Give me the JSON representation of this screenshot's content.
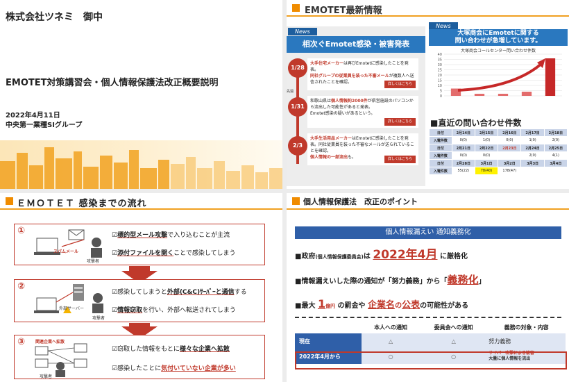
{
  "slide1": {
    "company": "株式会社ツネミ　御中",
    "title": "EMOTET対策講習会・個人情報保護法改正概要説明",
    "date": "2022年4月11日",
    "org": "中央第一業種SIグループ"
  },
  "slide2": {
    "header": "EMOTET最新情報",
    "news_tag": "News",
    "news_headline": "相次ぐEmotet感染・被害発表",
    "side_label": "先週",
    "items": [
      {
        "date": "1/28",
        "red": "大手住宅メーカー",
        "text1": "は再びEmotetに感染したことを発表。",
        "red2": "同社グループの従業員を装った不審メール",
        "text2": "が複数人へ送信されたことを確認。",
        "btn": "詳しくはこちら"
      },
      {
        "date": "1/31",
        "text0": "和歌山県は",
        "red": "個人情報約2000件",
        "text1": "が県営施設のパソコンから流出した可能性があると発表。",
        "text2": "Emotet感染の疑いがあるという。",
        "btn": "詳しくはこちら"
      },
      {
        "date": "2/3",
        "red": "大手生活用品メーカー",
        "text1": "はEmotetに感染したことを発表。同社従業員を装った不審なメールが送られていることを確認。",
        "red2": "個人情報の一部流出",
        "text2": "も。",
        "btn": "詳しくはこちら"
      }
    ],
    "news2_tag": "News",
    "news2_headline_1": "大塚商会にEmotetに関する",
    "news2_headline_2": "問い合わせが急増しています。",
    "chart_title": "大塚商会コールセンター問い合わせ件数",
    "table_title": "■直近の問い合わせ件数",
    "table": {
      "row_labels": [
        "日付",
        "入電件数"
      ],
      "weeks": [
        {
          "dates": [
            "2月14日",
            "2月15日",
            "2月16日",
            "2月17日",
            "2月18日"
          ],
          "counts": [
            "0(0)",
            "1(0)",
            "0(0)",
            "1(0)",
            "2(0)"
          ]
        },
        {
          "dates": [
            "2月21日",
            "2月22日",
            "2月23日",
            "2月24日",
            "2月25日"
          ],
          "counts": [
            "0(0)",
            "0(0)",
            "",
            "2(0)",
            "4(1)"
          ]
        },
        {
          "dates": [
            "2月28日",
            "3月1日",
            "3月2日",
            "3月3日",
            "3月4日"
          ],
          "counts": [
            "55(22)",
            "78(40)",
            "178(47)",
            "",
            ""
          ]
        }
      ]
    }
  },
  "chart_data": {
    "type": "bar",
    "title": "大塚商会コールセンター問い合わせ件数",
    "categories": [
      "",
      "",
      "",
      "",
      ""
    ],
    "values": [
      7,
      2,
      2,
      4,
      36
    ],
    "ylim": [
      0,
      40
    ],
    "yticks": [
      0,
      5,
      10,
      15,
      20,
      25,
      30,
      35,
      40
    ],
    "grid": true,
    "colors": {
      "bar": "#e36c6c",
      "bar_last": "#c62828",
      "trend_arrow": "#c62828"
    }
  },
  "slide3": {
    "header": "ＥＭＯＴＥＴ 感染までの流れ",
    "steps": [
      {
        "num": "①",
        "lines": [
          [
            "☑",
            "標的型メール攻撃",
            "で入り込むことが主流"
          ],
          [
            "☑",
            "添付ファイルを開く",
            "ことで感染してしまう"
          ]
        ],
        "labels": [
          "スパムメール",
          "攻撃者"
        ]
      },
      {
        "num": "②",
        "lines": [
          [
            "☑感染してしまうと",
            "外部(C&C)ｻｰﾊﾞｰと通信",
            "する"
          ],
          [
            "☑",
            "情報窃取",
            "を行い、外部へ転送されてしまう"
          ]
        ],
        "labels": [
          "外部サーバー",
          "攻撃者"
        ]
      },
      {
        "num": "③",
        "lines": [
          [
            "☑窃取した情報をもとに",
            "様々な企業へ拡散",
            ""
          ],
          [
            "☑感染したことに",
            "気付いていない企業が多い",
            ""
          ]
        ],
        "labels": [
          "関連企業へ拡散",
          "攻撃者"
        ]
      }
    ]
  },
  "slide4": {
    "header": "個人情報保護法　改正のポイント",
    "banner": "個人情報漏えい 通知義務化",
    "line1": {
      "pre": "■政府",
      "small": "(個人情報保護委員会)",
      "mid": "は ",
      "big": "2022年4月",
      "post": " に厳格化"
    },
    "line2": {
      "pre": "■情報漏えいした際の通知が「努力義務」から「",
      "big": "義務化",
      "post": "」"
    },
    "line3": {
      "pre": "■最大 ",
      "big": "1",
      "small": "億円",
      "mid": " の罰金や ",
      "big2": "企業名",
      "mid2": "の",
      "big3": "公表",
      "post": "の可能性がある"
    },
    "table": {
      "headers": [
        "",
        "本人への通知",
        "委員会への通知",
        "義務の対象・内容"
      ],
      "rows": [
        {
          "label": "現在",
          "c1": "△",
          "c2": "△",
          "c3": "努力義務"
        },
        {
          "label": "2022年4月から",
          "c1": "○",
          "c2": "○",
          "c3a": "サイバー攻撃による被害",
          "c3b": "大量に個人情報を流出"
        }
      ]
    }
  }
}
